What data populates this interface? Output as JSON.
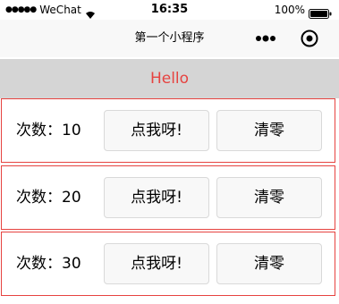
{
  "status_bar": {
    "carrier": "WeChat",
    "time": "16:35",
    "battery": "100%"
  },
  "nav": {
    "title": "第一个小程序"
  },
  "banner": {
    "text": "Hello"
  },
  "rows": [
    {
      "count_prefix": "次数：",
      "count_value": "10",
      "click_label": "点我呀!",
      "reset_label": "清零"
    },
    {
      "count_prefix": "次数：",
      "count_value": "20",
      "click_label": "点我呀!",
      "reset_label": "清零"
    },
    {
      "count_prefix": "次数：",
      "count_value": "30",
      "click_label": "点我呀!",
      "reset_label": "清零"
    }
  ],
  "colors": {
    "accent": "#e64340",
    "banner_bg": "#d5d5d5"
  },
  "icons": [
    "signal-dots-icon",
    "wifi-icon",
    "battery-icon",
    "more-icon",
    "close-icon"
  ]
}
